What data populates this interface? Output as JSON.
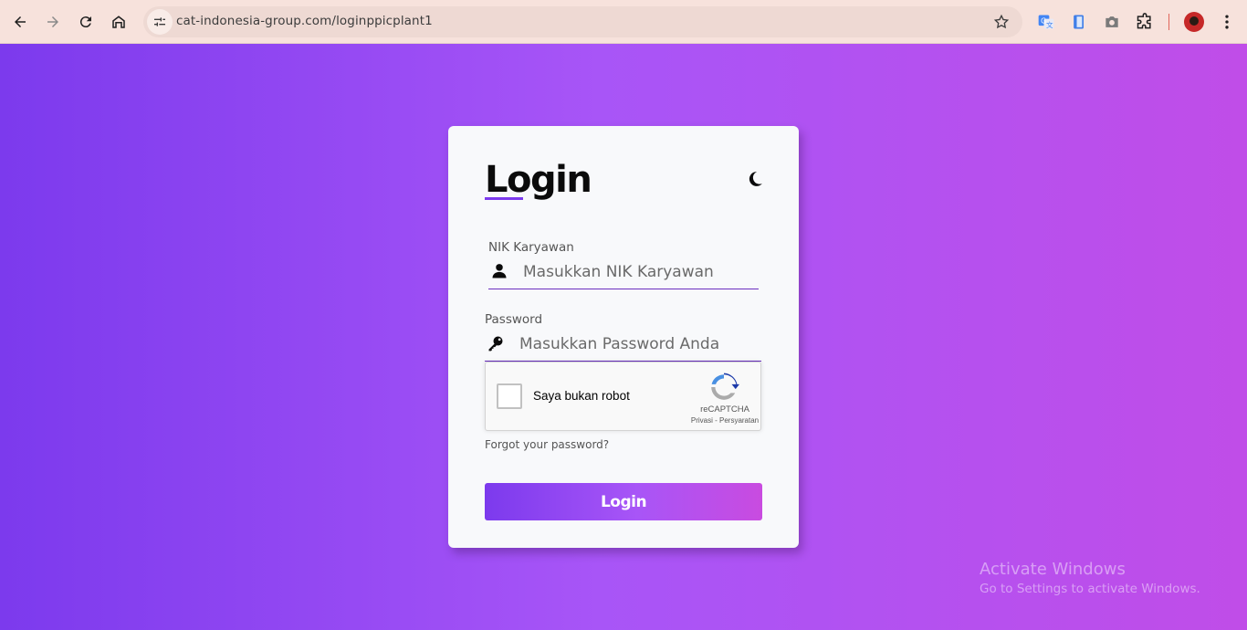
{
  "browser": {
    "url": "cat-indonesia-group.com/loginppicplant1"
  },
  "login_form": {
    "title": "Login",
    "nik_label": "NIK Karyawan",
    "nik_placeholder": "Masukkan NIK Karyawan",
    "password_label": "Password",
    "password_placeholder": "Masukkan Password Anda",
    "forgot_password": "Forgot your password?",
    "submit_label": "Login"
  },
  "recaptcha": {
    "label": "Saya bukan robot",
    "brand": "reCAPTCHA",
    "links": "Privasi - Persyaratan"
  },
  "windows_watermark": {
    "title": "Activate Windows",
    "subtitle": "Go to Settings to activate Windows."
  },
  "colors": {
    "accent": "#7c3aed",
    "gradient_end": "#c04de8",
    "card_bg": "#f8f9fb"
  }
}
